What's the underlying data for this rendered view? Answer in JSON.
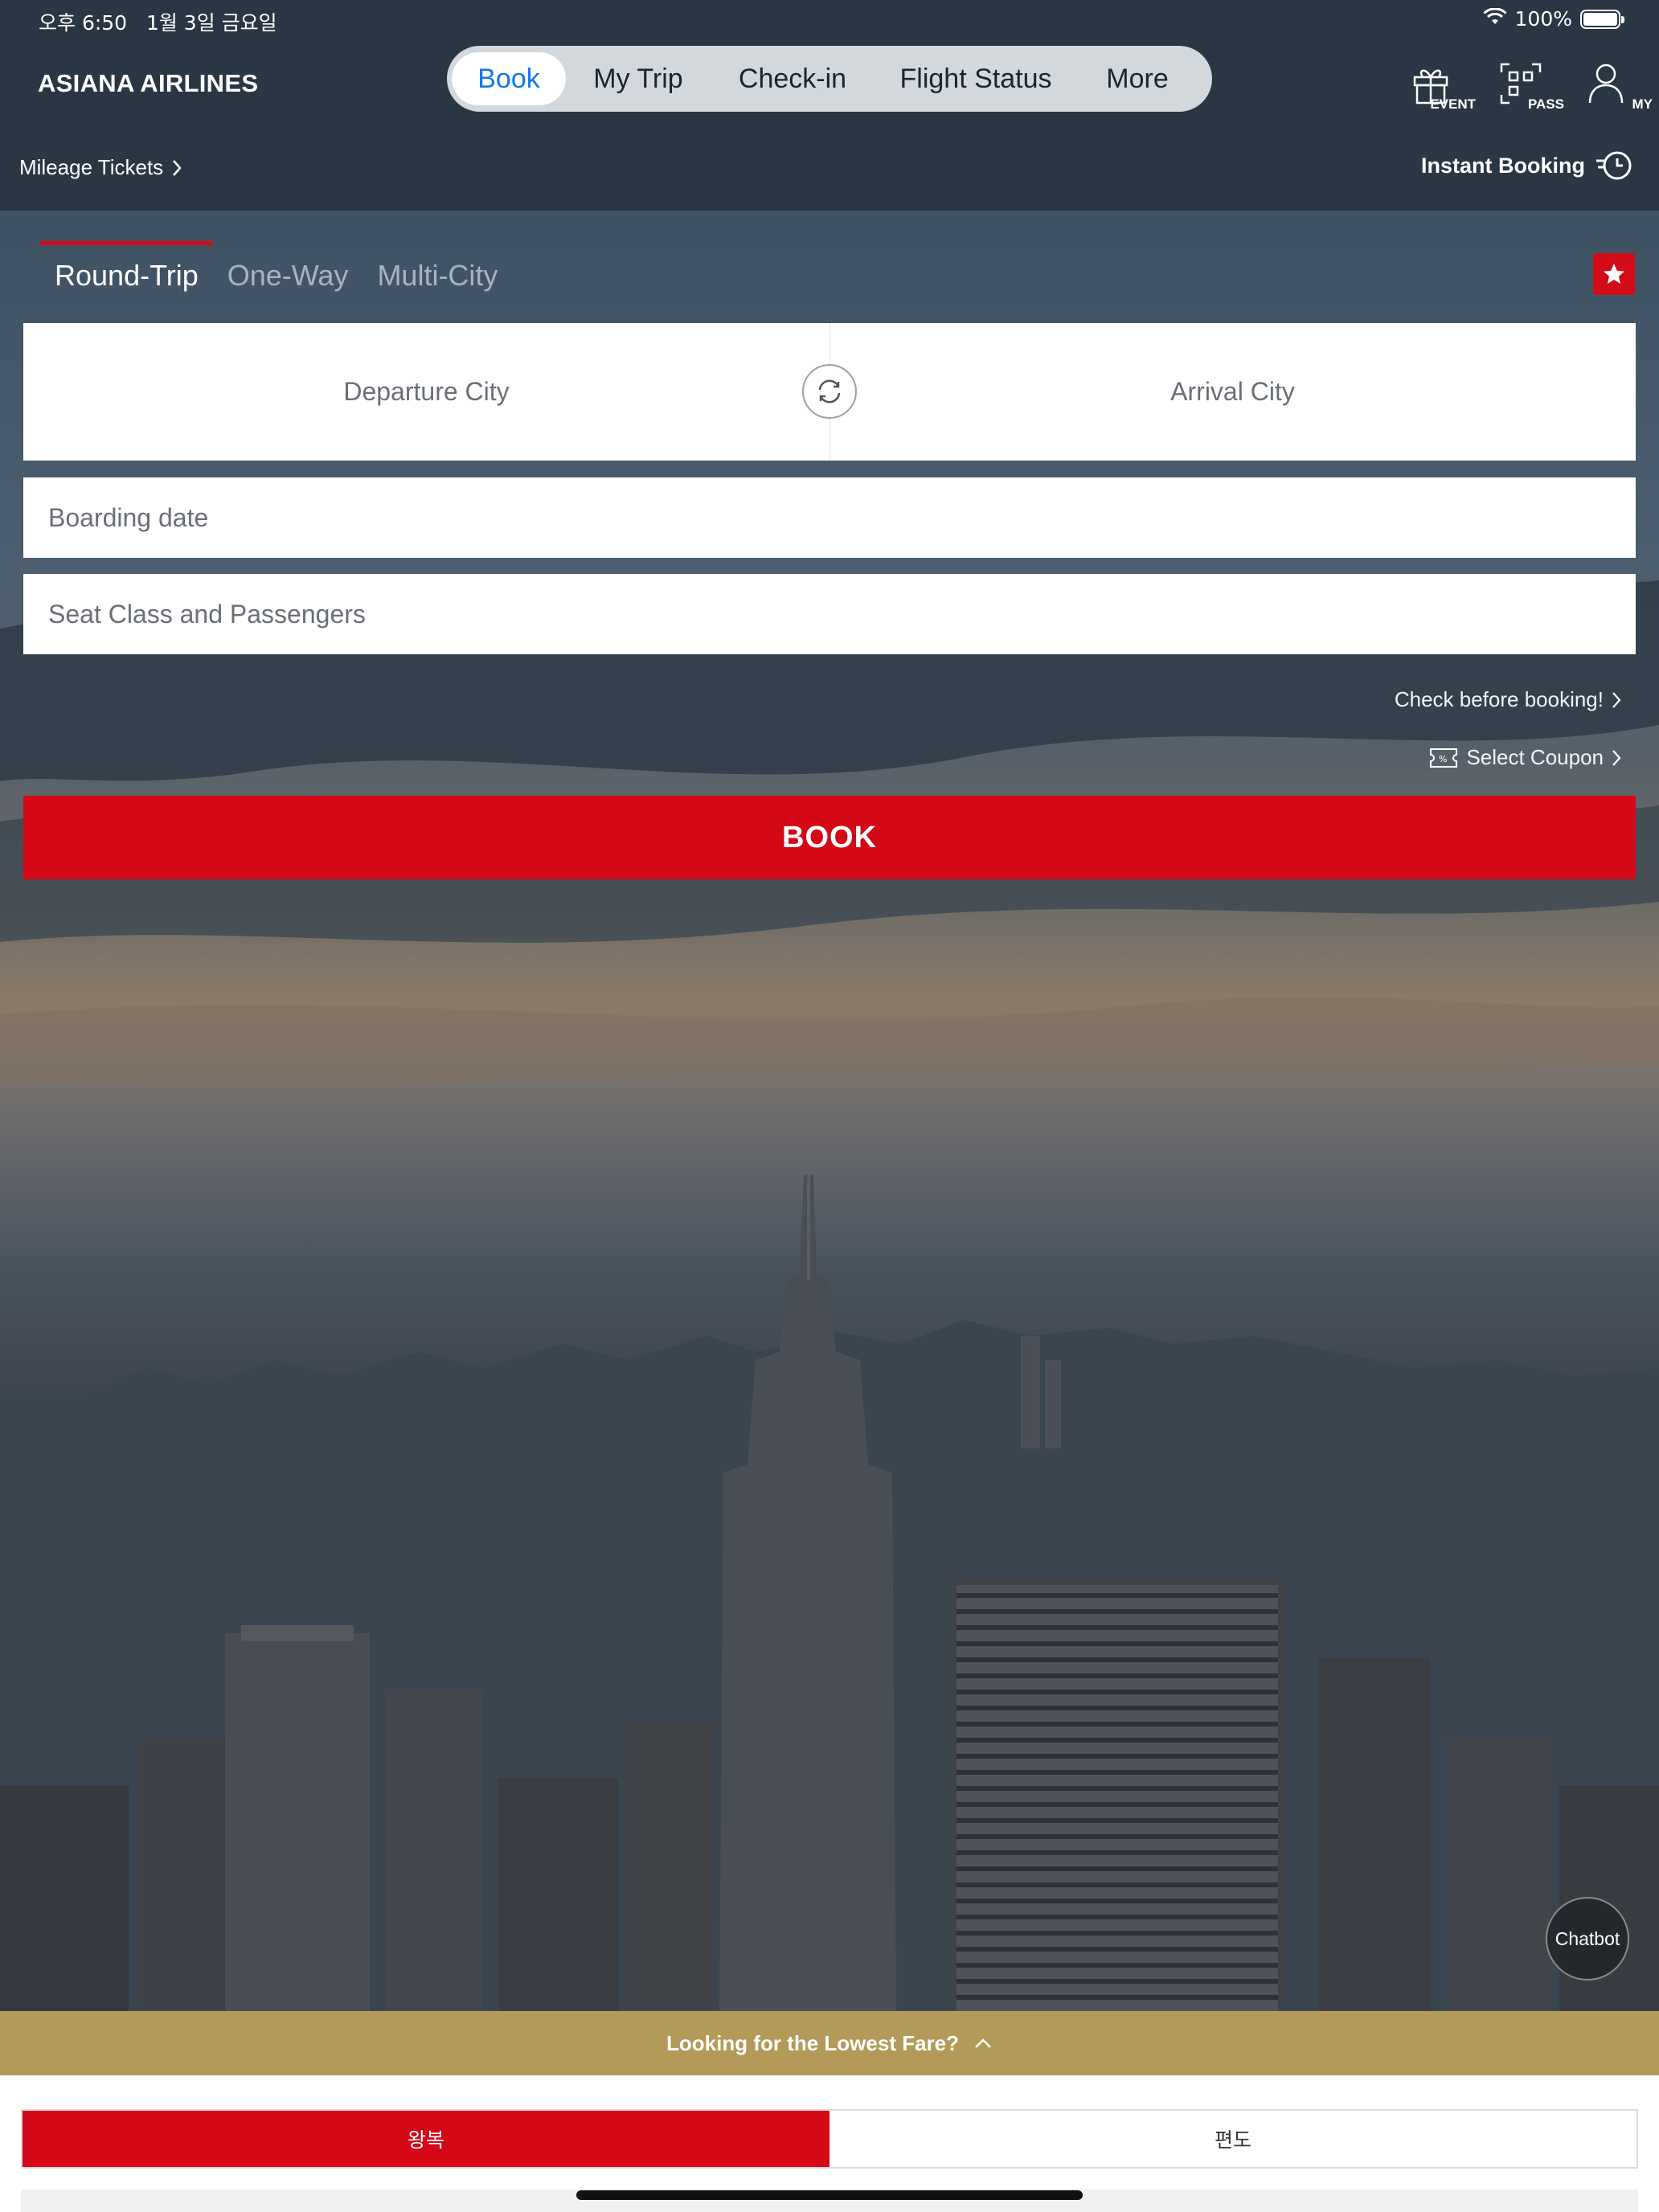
{
  "status_bar": {
    "time": "오후 6:50",
    "date": "1월 3일 금요일",
    "battery": "100%"
  },
  "app": {
    "logo": "ASIANA AIRLINES"
  },
  "nav": {
    "items": [
      "Book",
      "My Trip",
      "Check-in",
      "Flight Status",
      "More"
    ],
    "active": "Book"
  },
  "header_icons": {
    "event": "EVENT",
    "pass": "PASS",
    "my": "MY"
  },
  "subheader": {
    "mileage": "Mileage Tickets",
    "instant": "Instant Booking"
  },
  "booking": {
    "trip_tabs": [
      "Round-Trip",
      "One-Way",
      "Multi-City"
    ],
    "active_tab": "Round-Trip",
    "departure_placeholder": "Departure City",
    "arrival_placeholder": "Arrival City",
    "boarding_placeholder": "Boarding date",
    "seat_placeholder": "Seat Class and Passengers",
    "check_link": "Check before booking!",
    "coupon_link": "Select Coupon",
    "book_label": "BOOK"
  },
  "chatbot": {
    "label": "Chatbot"
  },
  "fare": {
    "label": "Looking for the Lowest Fare?",
    "options": [
      "왕복",
      "편도"
    ],
    "active": "왕복"
  },
  "colors": {
    "brand_red": "#d40816",
    "nav_active": "#1677e4",
    "fare_bar": "#b39a58",
    "header_bg": "#2a3643"
  }
}
